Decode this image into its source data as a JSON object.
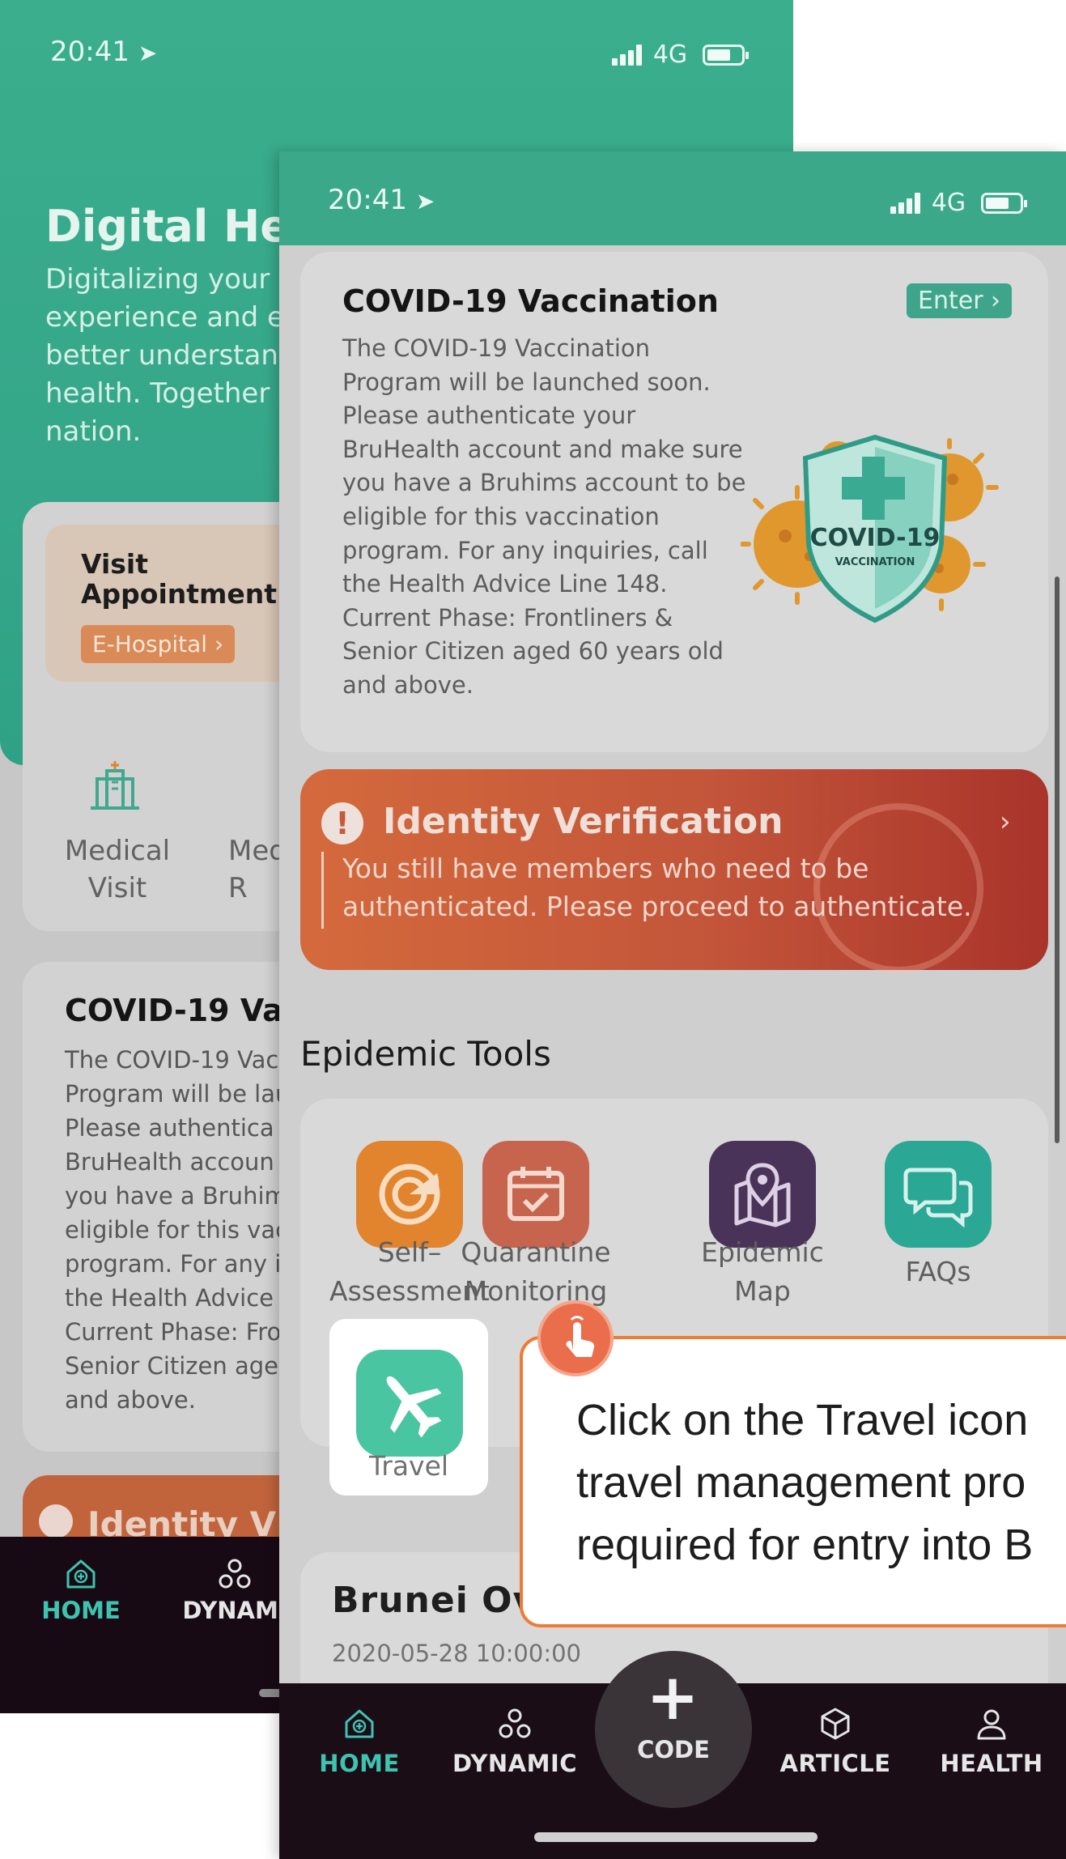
{
  "back_screen": {
    "status": {
      "time": "20:41",
      "network": "4G"
    },
    "title": "Digital Hea",
    "description_lines": [
      "Digitalizing your h",
      "experience and e",
      "better understan",
      "health. Together t",
      "nation."
    ],
    "visit": {
      "title": "Visit Appointment",
      "button": "E-Hospital"
    },
    "services": [
      {
        "label": "Medical Visit"
      },
      {
        "label": "Med\nR"
      }
    ],
    "vaccination": {
      "title": "COVID-19 Vac",
      "body": "The COVID-19 Vac\nProgram will be lau\nPlease authentica\nBruHealth accoun\nyou have a Bruhim\neligible for this vac\nprogram. For any i\nthe Health Advice\nCurrent Phase: Fro\nSenior Citizen age\nand above."
    },
    "identity_title": "Identity V",
    "nav": [
      {
        "label": "HOME",
        "active": true
      },
      {
        "label": "DYNAMI",
        "active": false
      }
    ]
  },
  "front_screen": {
    "status": {
      "time": "20:41",
      "network": "4G"
    },
    "vaccination": {
      "title": "COVID-19 Vaccination",
      "enter": "Enter ›",
      "body": "The COVID-19 Vaccination\nProgram will be launched soon.\nPlease authenticate your\nBruHealth account and make sure\nyou have a Bruhims account to be\neligible for this vaccination\nprogram. For any inquiries, call\nthe Health Advice Line 148.\nCurrent Phase: Frontliners &\nSenior Citizen aged 60 years old\nand above.",
      "badge_line1": "COVID-19",
      "badge_line2": "VACCINATION"
    },
    "identity": {
      "title": "Identity Verification",
      "text": "You still have members who need to be authenticated. Please proceed to authenticate."
    },
    "tools_heading": "Epidemic Tools",
    "tools": [
      {
        "label": "Self–\nAssessment",
        "icon": "radar-icon",
        "color": "#e2842d"
      },
      {
        "label": "Quarantine\nMonitoring",
        "icon": "calendar-check-icon",
        "color": "#c6644e"
      },
      {
        "label": "Epidemic\nMap",
        "icon": "map-pin-icon",
        "color": "#4a3358"
      },
      {
        "label": "FAQs",
        "icon": "chat-bubbles-icon",
        "color": "#2ba795"
      }
    ],
    "travel": {
      "label": "Travel",
      "icon": "airplane-icon",
      "color": "#4ac5a1"
    },
    "news": {
      "title": "Brunei Ov",
      "date": "2020-05-28 10:00:00"
    },
    "nav": [
      {
        "label": "HOME",
        "icon": "home-icon",
        "active": true
      },
      {
        "label": "DYNAMIC",
        "icon": "dynamic-icon",
        "active": false
      },
      {
        "label": "CODE",
        "icon": "plus-icon",
        "active": false
      },
      {
        "label": "ARTICLE",
        "icon": "cube-icon",
        "active": false
      },
      {
        "label": "HEALTH",
        "icon": "person-icon",
        "active": false
      }
    ]
  },
  "tooltip": {
    "lines": [
      "Click on the Travel icon",
      "travel management pro",
      "required for entry into B"
    ],
    "accent": "#ee7c37"
  },
  "colors": {
    "brand_green": "#3aa889",
    "accent_orange": "#ee7c37",
    "nav_active": "#3ec3b0",
    "nav_bg": "#1a0d16"
  }
}
